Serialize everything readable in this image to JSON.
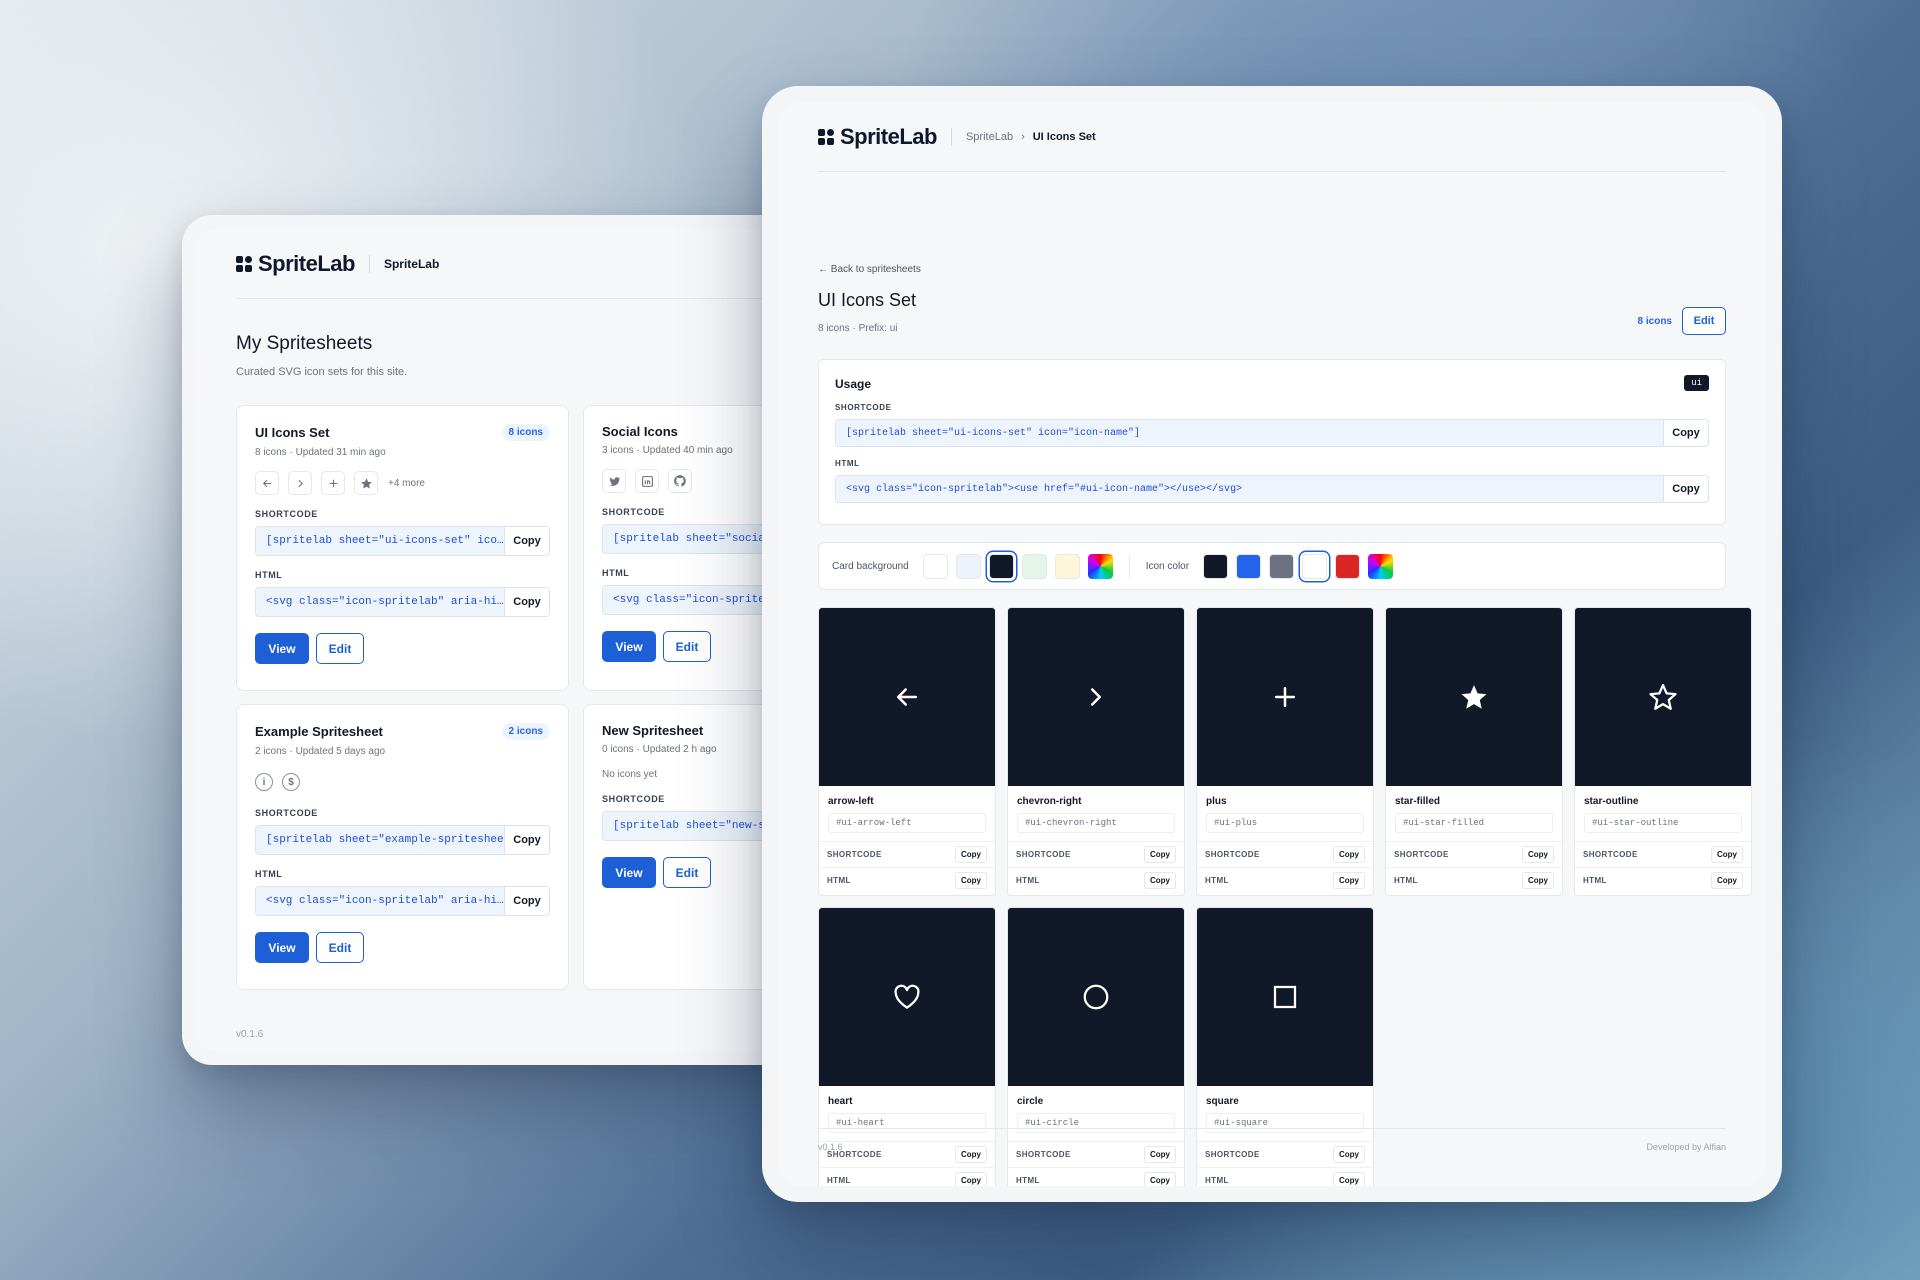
{
  "brand": {
    "name": "SpriteLab"
  },
  "back_window": {
    "header_app": "SpriteLab",
    "title": "My Spritesheets",
    "subtitle": "Curated SVG icon sets for this site.",
    "shortcode_label": "SHORTCODE",
    "html_label": "HTML",
    "copy_label": "Copy",
    "view_label": "View",
    "edit_label": "Edit",
    "version": "v0.1.6",
    "cards": [
      {
        "title": "UI Icons Set",
        "badge": "8 icons",
        "meta": "8 icons · Updated 31 min ago",
        "icons": [
          "arrow-left-icon",
          "chevron-right-icon",
          "plus-icon",
          "star-filled-icon"
        ],
        "more": "+4 more",
        "shortcode": "[spritelab sheet=\"ui-icons-set\" ico…",
        "html": "<svg class=\"icon-spritelab\" aria-hi…"
      },
      {
        "title": "Social Icons",
        "badge": "",
        "meta": "3 icons · Updated 40 min ago",
        "icons": [
          "twitter-icon",
          "linkedin-icon",
          "github-icon"
        ],
        "shortcode": "[spritelab sheet=\"social-",
        "html": "<svg class=\"icon-spritela"
      },
      {
        "title": "Example Spritesheet",
        "badge": "2 icons",
        "meta": "2 icons · Updated 5 days ago",
        "icons": [
          "info-icon",
          "dollar-icon"
        ],
        "shortcode": "[spritelab sheet=\"example-spritesheet…",
        "html": "<svg class=\"icon-spritelab\" aria-hi…"
      },
      {
        "title": "New Spritesheet",
        "badge": "",
        "meta": "0 icons · Updated 2 h ago",
        "empty_text": "No icons yet",
        "shortcode": "[spritelab sheet=\"new-spr"
      }
    ]
  },
  "front_window": {
    "breadcrumb": [
      "SpriteLab",
      "UI Icons Set"
    ],
    "back_link": "← Back to spritesheets",
    "title": "UI Icons Set",
    "subtitle": "8 icons · Prefix: ui",
    "count_link": "8 icons",
    "edit_label": "Edit",
    "usage": {
      "title": "Usage",
      "prefix": "ui",
      "shortcode_label": "SHORTCODE",
      "shortcode": "[spritelab sheet=\"ui-icons-set\" icon=\"icon-name\"]",
      "html_label": "HTML",
      "html": "<svg class=\"icon-spritelab\"><use href=\"#ui-icon-name\"></use></svg>",
      "copy_label": "Copy"
    },
    "card_background_label": "Card background",
    "icon_color_label": "Icon color",
    "card_backgrounds": [
      "#ffffff",
      "#eef3fb",
      "#111827",
      "#e3f6e9",
      "#fdf6d8",
      "rainbow"
    ],
    "card_background_selected": 2,
    "icon_colors": [
      "#111827",
      "#2563eb",
      "#6b7280",
      "#ffffff",
      "#dc2626",
      "rainbow"
    ],
    "icon_color_selected": 3,
    "icons": [
      {
        "name": "arrow-left",
        "id": "#ui-arrow-left",
        "glyph": "arrow-left-icon"
      },
      {
        "name": "chevron-right",
        "id": "#ui-chevron-right",
        "glyph": "chevron-right-icon"
      },
      {
        "name": "plus",
        "id": "#ui-plus",
        "glyph": "plus-icon"
      },
      {
        "name": "star-filled",
        "id": "#ui-star-filled",
        "glyph": "star-filled-icon"
      },
      {
        "name": "star-outline",
        "id": "#ui-star-outline",
        "glyph": "star-outline-icon"
      },
      {
        "name": "heart",
        "id": "#ui-heart",
        "glyph": "heart-icon"
      },
      {
        "name": "circle",
        "id": "#ui-circle",
        "glyph": "circle-icon"
      },
      {
        "name": "square",
        "id": "#ui-square",
        "glyph": "square-icon"
      }
    ],
    "tile_shortcode_label": "SHORTCODE",
    "tile_html_label": "HTML",
    "tile_copy_label": "Copy",
    "version": "v0.1.6",
    "developer": "Developed by Alfian"
  }
}
